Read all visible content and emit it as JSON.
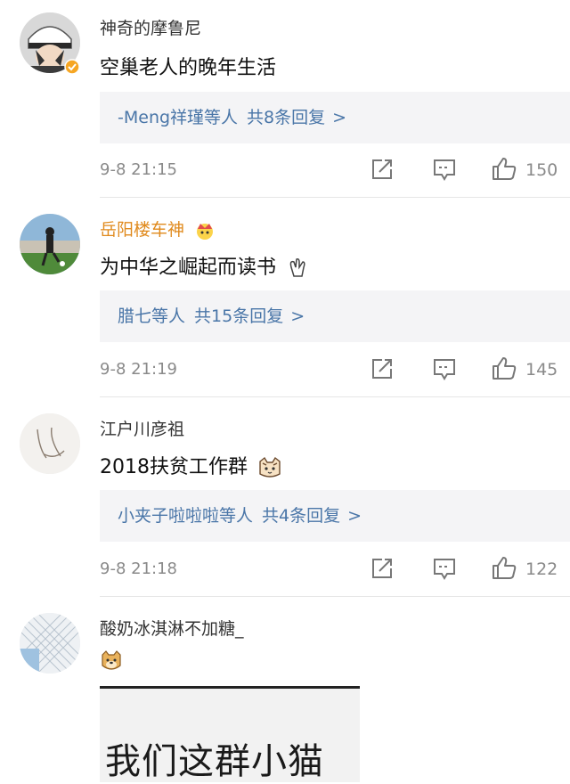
{
  "comments": [
    {
      "username": "神奇的摩鲁尼",
      "text": "空巢老人的晚年生活",
      "reply_users": "-Meng祥瑾等人",
      "reply_count": "共8条回复",
      "time": "9-8 21:15",
      "likes": "150"
    },
    {
      "username": "岳阳楼车神",
      "text": "为中华之崛起而读书",
      "reply_users": "腊七等人",
      "reply_count": "共15条回复",
      "time": "9-8 21:19",
      "likes": "145"
    },
    {
      "username": "江户川彦祖",
      "text": "2018扶贫工作群",
      "reply_users": "小夹子啦啦啦等人",
      "reply_count": "共4条回复",
      "time": "9-8 21:18",
      "likes": "122"
    },
    {
      "username": "酸奶冰淇淋不加糖_"
    }
  ],
  "reply_arrow": ">",
  "bottom_image_text": "我们这群小猫",
  "icons": {
    "share": "share-icon",
    "comment": "comment-icon",
    "like": "thumbs-up-icon",
    "vip": "verified-badge-icon",
    "crown": "crown-badge-icon"
  },
  "colors": {
    "link": "#4a76a8",
    "gold_name": "#e08a1d",
    "meta": "#8a8a8a",
    "reply_bg": "#f4f4f6"
  }
}
